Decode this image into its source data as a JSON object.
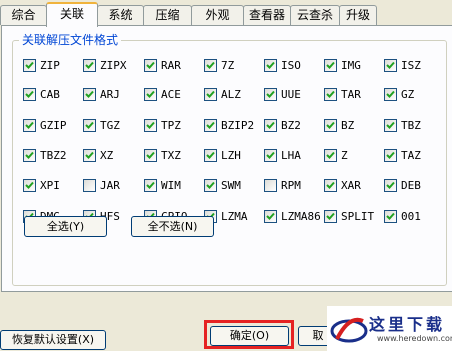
{
  "tabs": [
    "综合",
    "关联",
    "系统",
    "压缩",
    "外观",
    "查看器",
    "云查杀",
    "升级"
  ],
  "active_tab": 1,
  "group_title": "关联解压文件格式",
  "formats": [
    {
      "label": "ZIP",
      "checked": true
    },
    {
      "label": "ZIPX",
      "checked": true
    },
    {
      "label": "RAR",
      "checked": true
    },
    {
      "label": "7Z",
      "checked": true
    },
    {
      "label": "ISO",
      "checked": true
    },
    {
      "label": "IMG",
      "checked": true
    },
    {
      "label": "ISZ",
      "checked": true
    },
    {
      "label": "CAB",
      "checked": true
    },
    {
      "label": "ARJ",
      "checked": true
    },
    {
      "label": "ACE",
      "checked": true
    },
    {
      "label": "ALZ",
      "checked": true
    },
    {
      "label": "UUE",
      "checked": true
    },
    {
      "label": "TAR",
      "checked": true
    },
    {
      "label": "GZ",
      "checked": true
    },
    {
      "label": "GZIP",
      "checked": true
    },
    {
      "label": "TGZ",
      "checked": true
    },
    {
      "label": "TPZ",
      "checked": true
    },
    {
      "label": "BZIP2",
      "checked": true
    },
    {
      "label": "BZ2",
      "checked": true
    },
    {
      "label": "BZ",
      "checked": true
    },
    {
      "label": "TBZ",
      "checked": true
    },
    {
      "label": "TBZ2",
      "checked": true
    },
    {
      "label": "XZ",
      "checked": true
    },
    {
      "label": "TXZ",
      "checked": true
    },
    {
      "label": "LZH",
      "checked": true
    },
    {
      "label": "LHA",
      "checked": true
    },
    {
      "label": "Z",
      "checked": true
    },
    {
      "label": "TAZ",
      "checked": true
    },
    {
      "label": "XPI",
      "checked": true
    },
    {
      "label": "JAR",
      "checked": false
    },
    {
      "label": "WIM",
      "checked": true
    },
    {
      "label": "SWM",
      "checked": true
    },
    {
      "label": "RPM",
      "checked": false
    },
    {
      "label": "XAR",
      "checked": true
    },
    {
      "label": "DEB",
      "checked": true
    },
    {
      "label": "DMG",
      "checked": true
    },
    {
      "label": "HFS",
      "checked": true
    },
    {
      "label": "CPIO",
      "checked": true
    },
    {
      "label": "LZMA",
      "checked": true
    },
    {
      "label": "LZMA86",
      "checked": true
    },
    {
      "label": "SPLIT",
      "checked": true
    },
    {
      "label": "001",
      "checked": true
    }
  ],
  "buttons": {
    "select_all": "全选(Y)",
    "select_none": "全不选(N)",
    "restore_defaults": "恢复默认设置(X)",
    "ok": "确定(O)",
    "cancel_partial": "取"
  },
  "watermark": {
    "text": "这里下载",
    "url": "www.heredown.com"
  }
}
